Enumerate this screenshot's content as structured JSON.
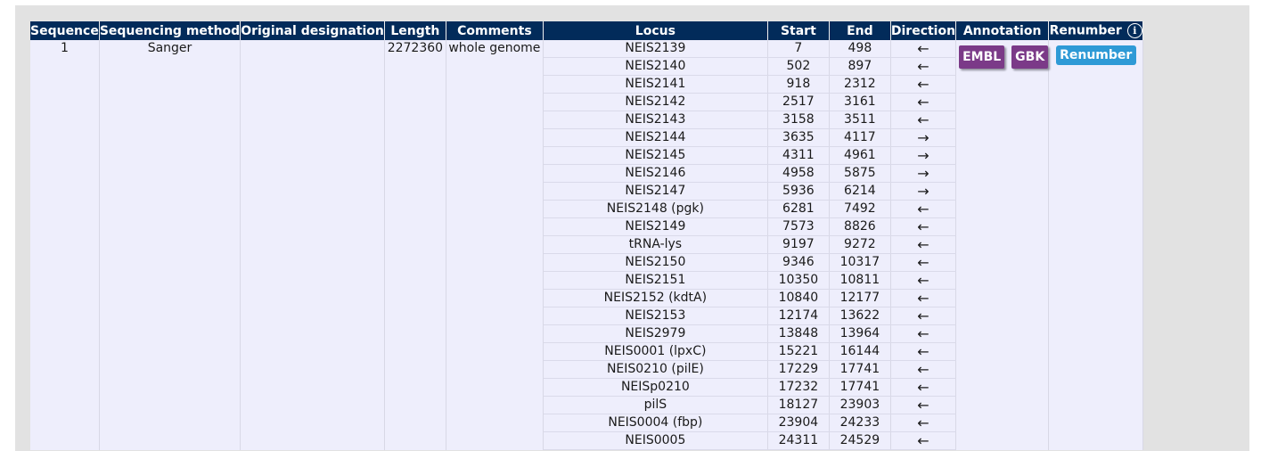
{
  "columns": {
    "sequence": "Sequence",
    "method": "Sequencing method",
    "designation": "Original designation",
    "length": "Length",
    "comments": "Comments",
    "locus": "Locus",
    "start": "Start",
    "end": "End",
    "direction": "Direction",
    "annotation": "Annotation",
    "renumber": "Renumber"
  },
  "record": {
    "sequence": "1",
    "method": "Sanger",
    "designation": "",
    "length": "2272360",
    "comments": "whole genome"
  },
  "buttons": {
    "embl": "EMBL",
    "gbk": "GBK",
    "renumber": "Renumber"
  },
  "icons": {
    "info": "i"
  },
  "loci": [
    {
      "locus": "NEIS2139",
      "start": "7",
      "end": "498",
      "dir": "←"
    },
    {
      "locus": "NEIS2140",
      "start": "502",
      "end": "897",
      "dir": "←"
    },
    {
      "locus": "NEIS2141",
      "start": "918",
      "end": "2312",
      "dir": "←"
    },
    {
      "locus": "NEIS2142",
      "start": "2517",
      "end": "3161",
      "dir": "←"
    },
    {
      "locus": "NEIS2143",
      "start": "3158",
      "end": "3511",
      "dir": "←"
    },
    {
      "locus": "NEIS2144",
      "start": "3635",
      "end": "4117",
      "dir": "→"
    },
    {
      "locus": "NEIS2145",
      "start": "4311",
      "end": "4961",
      "dir": "→"
    },
    {
      "locus": "NEIS2146",
      "start": "4958",
      "end": "5875",
      "dir": "→"
    },
    {
      "locus": "NEIS2147",
      "start": "5936",
      "end": "6214",
      "dir": "→"
    },
    {
      "locus": "NEIS2148 (pgk)",
      "start": "6281",
      "end": "7492",
      "dir": "←"
    },
    {
      "locus": "NEIS2149",
      "start": "7573",
      "end": "8826",
      "dir": "←"
    },
    {
      "locus": "tRNA-lys",
      "start": "9197",
      "end": "9272",
      "dir": "←"
    },
    {
      "locus": "NEIS2150",
      "start": "9346",
      "end": "10317",
      "dir": "←"
    },
    {
      "locus": "NEIS2151",
      "start": "10350",
      "end": "10811",
      "dir": "←"
    },
    {
      "locus": "NEIS2152 (kdtA)",
      "start": "10840",
      "end": "12177",
      "dir": "←"
    },
    {
      "locus": "NEIS2153",
      "start": "12174",
      "end": "13622",
      "dir": "←"
    },
    {
      "locus": "NEIS2979",
      "start": "13848",
      "end": "13964",
      "dir": "←"
    },
    {
      "locus": "NEIS0001 (lpxC)",
      "start": "15221",
      "end": "16144",
      "dir": "←"
    },
    {
      "locus": "NEIS0210 (pilE)",
      "start": "17229",
      "end": "17741",
      "dir": "←"
    },
    {
      "locus": "NEISp0210",
      "start": "17232",
      "end": "17741",
      "dir": "←"
    },
    {
      "locus": "pilS",
      "start": "18127",
      "end": "23903",
      "dir": "←"
    },
    {
      "locus": "NEIS0004 (fbp)",
      "start": "23904",
      "end": "24233",
      "dir": "←"
    },
    {
      "locus": "NEIS0005",
      "start": "24311",
      "end": "24529",
      "dir": "←"
    }
  ]
}
